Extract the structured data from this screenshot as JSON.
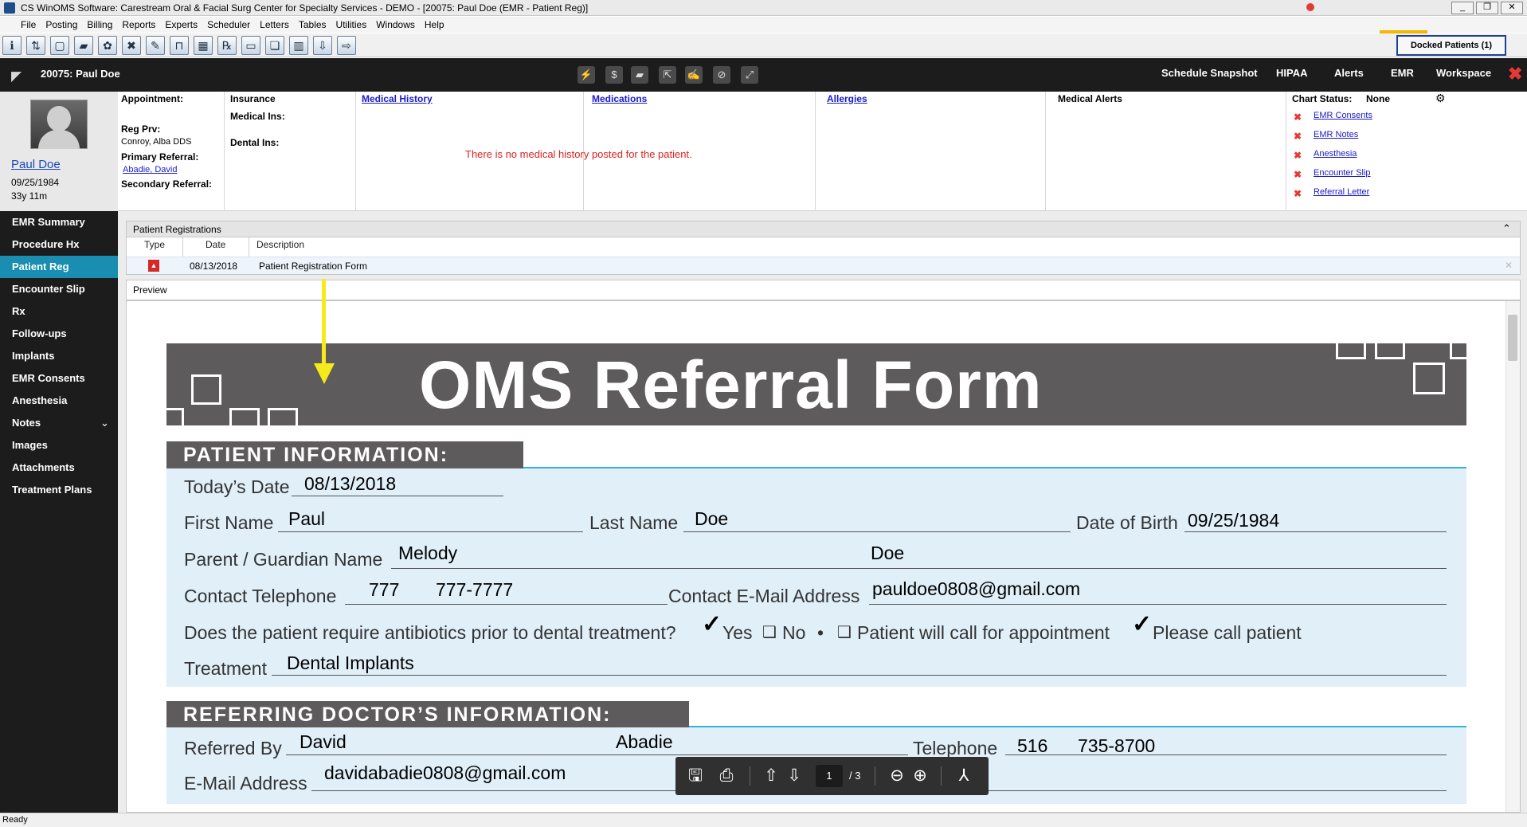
{
  "window": {
    "title": "CS WinOMS Software:  Carestream Oral & Facial Surg Center for Specialty Services - DEMO - [20075: Paul Doe (EMR - Patient Reg)]"
  },
  "menu": [
    "File",
    "Posting",
    "Billing",
    "Reports",
    "Experts",
    "Scheduler",
    "Letters",
    "Tables",
    "Utilities",
    "Windows",
    "Help"
  ],
  "toolbar": {
    "docked_patients": "Docked Patients (1)"
  },
  "header": {
    "patient_title": "20075: Paul Doe",
    "nav": [
      "Schedule Snapshot",
      "HIPAA",
      "Alerts",
      "EMR",
      "Workspace"
    ],
    "active_nav": "EMR"
  },
  "patient": {
    "name": "Paul Doe",
    "dob": "09/25/1984",
    "age": "33y 11m"
  },
  "info": {
    "appointment_label": "Appointment:",
    "reg_prv_label": "Reg Prv:",
    "reg_prv": "Conroy, Alba DDS",
    "primary_referral_label": "Primary Referral:",
    "primary_referral": "Abadie, David",
    "secondary_referral_label": "Secondary Referral:",
    "insurance_label": "Insurance",
    "medical_ins_label": "Medical Ins:",
    "dental_ins_label": "Dental Ins:",
    "medical_history_link": "Medical History ",
    "medications_link": "Medications ",
    "allergies_link": "Allergies ",
    "no_history_msg": "There is no medical history posted for the patient.",
    "medical_alerts_label": "Medical Alerts",
    "chart_status_label": "Chart Status:",
    "chart_status_value": "None",
    "chart_items": [
      "EMR Consents",
      "EMR Notes",
      "Anesthesia",
      "Encounter Slip",
      "Referral Letter"
    ]
  },
  "sidebar": {
    "items": [
      "EMR Summary",
      "Procedure Hx",
      "Patient Reg",
      "Encounter Slip",
      "Rx",
      "Follow-ups",
      "Implants",
      "EMR Consents",
      "Anesthesia",
      "Notes",
      "Images",
      "Attachments",
      "Treatment Plans"
    ],
    "active": "Patient Reg"
  },
  "registrations": {
    "title": "Patient Registrations",
    "columns": [
      "Type",
      "Date",
      "Description"
    ],
    "rows": [
      {
        "type_icon": "pdf-icon",
        "date": "08/13/2018",
        "description": "Patient Registration Form"
      }
    ]
  },
  "preview": {
    "label": "Preview"
  },
  "form": {
    "title": "OMS Referral Form",
    "patient_section": "PATIENT INFORMATION:",
    "todays_date_label": "Today’s Date",
    "todays_date": "08/13/2018",
    "first_name_label": "First Name",
    "first_name": "Paul",
    "last_name_label": "Last Name",
    "last_name": "Doe",
    "dob_label": "Date of Birth",
    "dob": "09/25/1984",
    "guardian_label": "Parent / Guardian Name",
    "guardian_first": "Melody",
    "guardian_last": "Doe",
    "phone_label": "Contact Telephone",
    "phone_area": "777",
    "phone_number": "777-7777",
    "email_label": "Contact E-Mail Address",
    "email": "pauldoe0808@gmail.com",
    "antibiotics_q": "Does the patient require antibiotics prior to dental treatment?",
    "yes": "Yes",
    "no": "No",
    "bullet": "•",
    "will_call": "Patient will call for appointment",
    "please_call": "Please call patient",
    "treatment_label": "Treatment",
    "treatment": "Dental Implants",
    "doctor_section": "REFERRING DOCTOR’S INFORMATION:",
    "referred_by_label": "Referred By",
    "ref_first": "David",
    "ref_last": "Abadie",
    "telephone_label": "Telephone",
    "tel_area": "516",
    "tel_number": "735-8700",
    "doc_email_label": "E-Mail Address",
    "doc_email": "davidabadie0808@gmail.com"
  },
  "pdf_toolbar": {
    "page": "1",
    "total": "/ 3"
  },
  "status": "Ready",
  "colors": {
    "accent": "#1a8eb0",
    "header_bg": "#1c1c1c",
    "emr_underline": "#f2b700",
    "error_red": "#e02020"
  }
}
